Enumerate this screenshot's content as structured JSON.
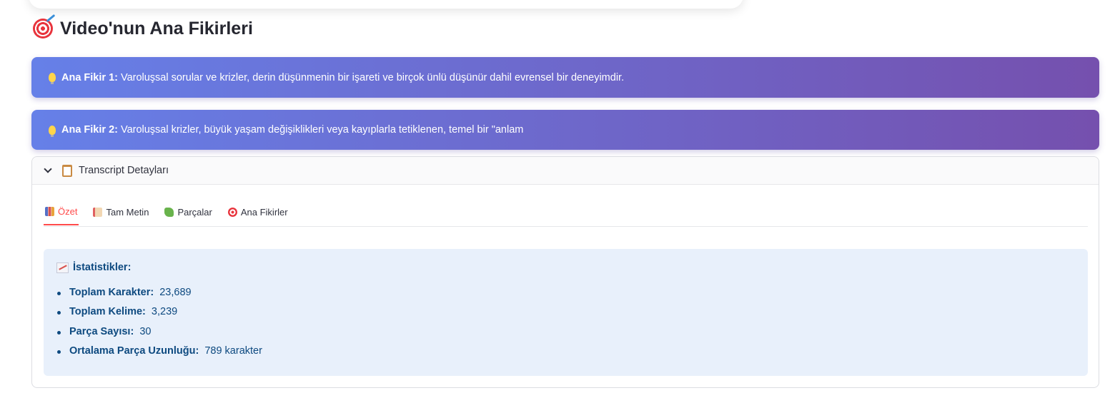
{
  "header": {
    "title": "Video'nun Ana Fikirleri",
    "icon": "target-icon"
  },
  "ideas": [
    {
      "label": "Ana Fikir 1:",
      "text": "Varoluşsal sorular ve krizler, derin düşünmenin bir işareti ve birçok ünlü düşünür dahil evrensel bir deneyimdir.",
      "icon": "lightbulb-icon"
    },
    {
      "label": "Ana Fikir 2:",
      "text": "Varoluşsal krizler, büyük yaşam değişiklikleri veya kayıplarla tetiklenen, temel bir \"anlam",
      "icon": "lightbulb-icon"
    }
  ],
  "expander": {
    "title": "Transcript Detayları",
    "icon": "clipboard-icon",
    "expanded": true
  },
  "tabs": [
    {
      "label": "Özet",
      "icon": "bar-chart-icon",
      "active": true
    },
    {
      "label": "Tam Metin",
      "icon": "memo-icon",
      "active": false
    },
    {
      "label": "Parçalar",
      "icon": "puzzle-icon",
      "active": false
    },
    {
      "label": "Ana Fikirler",
      "icon": "target-icon",
      "active": false
    }
  ],
  "stats": {
    "title": "İstatistikler:",
    "icon": "trend-chart-icon",
    "items": [
      {
        "label": "Toplam Karakter:",
        "value": "23,689"
      },
      {
        "label": "Toplam Kelime:",
        "value": "3,239"
      },
      {
        "label": "Parça Sayısı:",
        "value": "30"
      },
      {
        "label": "Ortalama Parça Uzunluğu:",
        "value": "789 karakter"
      }
    ]
  },
  "colors": {
    "gradient_start": "#6680e8",
    "gradient_end": "#7550ae",
    "active_tab": "#ff4b4b",
    "info_background": "#e8f0fb",
    "info_text": "#0e4a80"
  }
}
